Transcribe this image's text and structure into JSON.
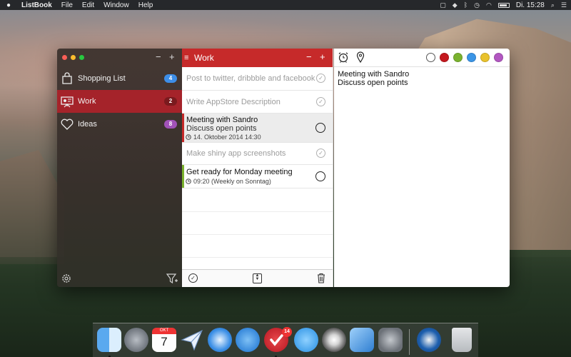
{
  "menubar": {
    "app_name": "ListBook",
    "menus": [
      "File",
      "Edit",
      "Window",
      "Help"
    ],
    "clock": "Di. 15:28"
  },
  "sidebar": {
    "items": [
      {
        "label": "Shopping List",
        "count": "4",
        "icon": "shopping-bag-icon",
        "badge_color": "#3d8ee8"
      },
      {
        "label": "Work",
        "count": "2",
        "icon": "presentation-board-icon",
        "badge_color": "#7a1a1e"
      },
      {
        "label": "Ideas",
        "count": "8",
        "icon": "heart-icon",
        "badge_color": "#a152b8"
      }
    ],
    "active_index": 1
  },
  "list": {
    "title": "Work",
    "tasks": [
      {
        "title": "Post to twitter, dribbble and facebook",
        "done": true
      },
      {
        "title": "Write AppStore Description",
        "done": true
      },
      {
        "title": "Meeting with Sandro",
        "note": "Discuss open points",
        "meta": "14. Oktober 2014 14:30",
        "done": false,
        "selected": true,
        "marker_color": "#c62a2a"
      },
      {
        "title": "Make shiny app screenshots",
        "done": true
      },
      {
        "title": "Get ready for Monday meeting",
        "meta": "09:20 (Weekly on Sonntag)",
        "done": false,
        "marker_color": "#7ab22e"
      }
    ]
  },
  "detail": {
    "line1": "Meeting with Sandro",
    "line2": "Discuss open points",
    "colors": [
      "#ffffff",
      "#c4181e",
      "#7ab22e",
      "#3b95e6",
      "#e9c22c",
      "#b257c1"
    ]
  },
  "dock": {
    "items": [
      "finder-icon",
      "launchpad-icon",
      "calendar-icon",
      "mail-icon",
      "safari-icon",
      "tags-icon",
      "listbook-icon",
      "messages-icon",
      "dvd-player-icon",
      "xcode-icon",
      "system-preferences-icon",
      "onepassword-icon",
      "trash-icon"
    ],
    "calendar_month": "OKT",
    "calendar_day": "7",
    "listbook_badge": "14"
  }
}
